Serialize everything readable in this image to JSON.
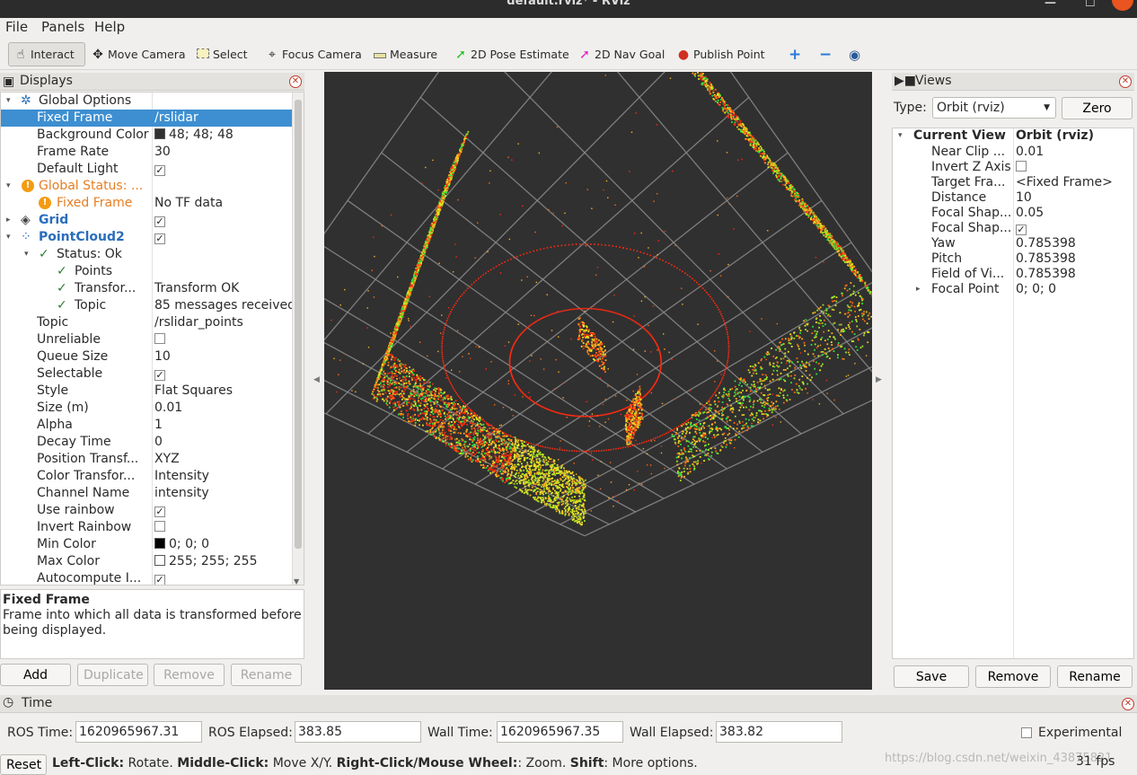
{
  "window": {
    "title": "default.rviz* - RViz"
  },
  "menu": [
    "File",
    "Panels",
    "Help"
  ],
  "toolbar": {
    "tools": [
      {
        "label": "Interact",
        "icon": "hand-pointer-icon"
      },
      {
        "label": "Move Camera",
        "icon": "move-camera-icon"
      },
      {
        "label": "Select",
        "icon": "select-box-icon"
      },
      {
        "label": "Focus Camera",
        "icon": "focus-crosshair-icon"
      },
      {
        "label": "Measure",
        "icon": "ruler-icon"
      },
      {
        "label": "2D Pose Estimate",
        "icon": "green-arrow-icon"
      },
      {
        "label": "2D Nav Goal",
        "icon": "magenta-arrow-icon"
      },
      {
        "label": "Publish Point",
        "icon": "map-pin-icon"
      }
    ],
    "colors": {
      "pose": "#22c022",
      "nav": "#e020c8",
      "pin": "#d03020",
      "plus": "#2a7ad8"
    }
  },
  "displays": {
    "title": "Displays",
    "rows": [
      {
        "label": "Global Options",
        "value": ""
      },
      {
        "label": "Fixed Frame",
        "value": "/rslidar"
      },
      {
        "label": "Background Color",
        "value": "48; 48; 48"
      },
      {
        "label": "Frame Rate",
        "value": "30"
      },
      {
        "label": "Default Light",
        "value": "✓"
      },
      {
        "label": "Global Status: ...",
        "value": ""
      },
      {
        "label": "Fixed Frame",
        "value": "No TF data"
      },
      {
        "label": "Grid",
        "value": "✓"
      },
      {
        "label": "PointCloud2",
        "value": "✓"
      },
      {
        "label": "Status: Ok",
        "value": ""
      },
      {
        "label": "Points",
        "value": ""
      },
      {
        "label": "Transfor...",
        "value": "Transform OK"
      },
      {
        "label": "Topic",
        "value": "85 messages received"
      },
      {
        "label": "Topic",
        "value": "/rslidar_points"
      },
      {
        "label": "Unreliable",
        "value": ""
      },
      {
        "label": "Queue Size",
        "value": "10"
      },
      {
        "label": "Selectable",
        "value": "✓"
      },
      {
        "label": "Style",
        "value": "Flat Squares"
      },
      {
        "label": "Size (m)",
        "value": "0.01"
      },
      {
        "label": "Alpha",
        "value": "1"
      },
      {
        "label": "Decay Time",
        "value": "0"
      },
      {
        "label": "Position Transf...",
        "value": "XYZ"
      },
      {
        "label": "Color Transfor...",
        "value": "Intensity"
      },
      {
        "label": "Channel Name",
        "value": "intensity"
      },
      {
        "label": "Use rainbow",
        "value": "✓"
      },
      {
        "label": "Invert Rainbow",
        "value": ""
      },
      {
        "label": "Min Color",
        "value": "0; 0; 0"
      },
      {
        "label": "Max Color",
        "value": "255; 255; 255"
      },
      {
        "label": "Autocompute I...",
        "value": "✓"
      }
    ],
    "swatches": {
      "background": "#303030",
      "min": "#000000",
      "max": "#ffffff"
    },
    "description_title": "Fixed Frame",
    "description_text": "Frame into which all data is transformed before being displayed.",
    "buttons": {
      "add": "Add",
      "duplicate": "Duplicate",
      "remove": "Remove",
      "rename": "Rename"
    }
  },
  "views": {
    "title": "Views",
    "type_label": "Type:",
    "type_value": "Orbit (rviz)",
    "zero": "Zero",
    "rows": [
      {
        "label": "Current View",
        "value": "Orbit (rviz)"
      },
      {
        "label": "Near Clip ...",
        "value": "0.01"
      },
      {
        "label": "Invert Z Axis",
        "value": ""
      },
      {
        "label": "Target Fra...",
        "value": "<Fixed Frame>"
      },
      {
        "label": "Distance",
        "value": "10"
      },
      {
        "label": "Focal Shap...",
        "value": "0.05"
      },
      {
        "label": "Focal Shap...",
        "value": "✓"
      },
      {
        "label": "Yaw",
        "value": "0.785398"
      },
      {
        "label": "Pitch",
        "value": "0.785398"
      },
      {
        "label": "Field of Vi...",
        "value": "0.785398"
      },
      {
        "label": "Focal Point",
        "value": "0; 0; 0"
      }
    ],
    "buttons": {
      "save": "Save",
      "remove": "Remove",
      "rename": "Rename"
    }
  },
  "time": {
    "title": "Time",
    "ros_time_label": "ROS Time:",
    "ros_time": "1620965967.31",
    "ros_elapsed_label": "ROS Elapsed:",
    "ros_elapsed": "383.85",
    "wall_time_label": "Wall Time:",
    "wall_time": "1620965967.35",
    "wall_elapsed_label": "Wall Elapsed:",
    "wall_elapsed": "383.82",
    "experimental": "Experimental"
  },
  "status": {
    "reset": "Reset",
    "left_click": "Left-Click:",
    "left_desc": " Rotate. ",
    "middle_click": "Middle-Click:",
    "middle_desc": " Move X/Y. ",
    "right_click": "Right-Click/Mouse Wheel:",
    "right_desc": ": Zoom. ",
    "shift": "Shift",
    "shift_desc": ": More options.",
    "fps": "31 fps",
    "watermark": "https://blog.csdn.net/weixin_43875821"
  },
  "viewport": {
    "background": "#303030",
    "grid_color": "#8c8c8c",
    "cloud_colors": [
      "#ff2a10",
      "#ff6a10",
      "#ffb020",
      "#e8e820",
      "#9ee820",
      "#30e040"
    ]
  }
}
